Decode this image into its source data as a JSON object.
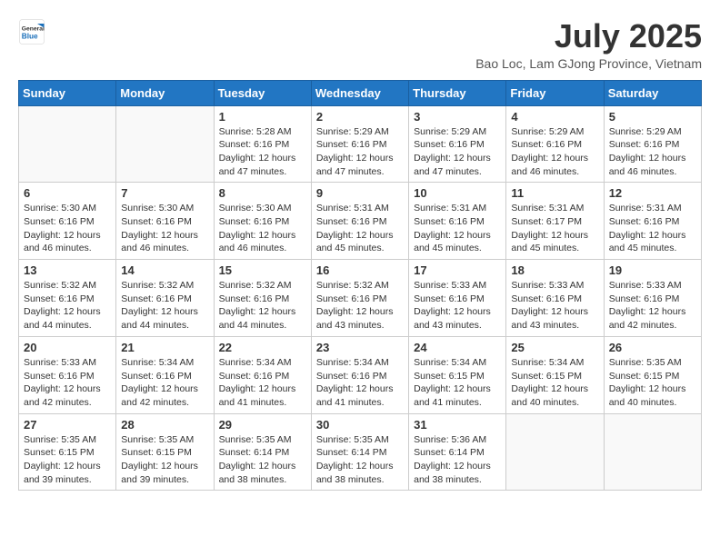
{
  "header": {
    "logo_general": "General",
    "logo_blue": "Blue",
    "month_year": "July 2025",
    "location": "Bao Loc, Lam GJong Province, Vietnam"
  },
  "days_of_week": [
    "Sunday",
    "Monday",
    "Tuesday",
    "Wednesday",
    "Thursday",
    "Friday",
    "Saturday"
  ],
  "weeks": [
    [
      {
        "day": "",
        "info": ""
      },
      {
        "day": "",
        "info": ""
      },
      {
        "day": "1",
        "info": "Sunrise: 5:28 AM\nSunset: 6:16 PM\nDaylight: 12 hours and 47 minutes."
      },
      {
        "day": "2",
        "info": "Sunrise: 5:29 AM\nSunset: 6:16 PM\nDaylight: 12 hours and 47 minutes."
      },
      {
        "day": "3",
        "info": "Sunrise: 5:29 AM\nSunset: 6:16 PM\nDaylight: 12 hours and 47 minutes."
      },
      {
        "day": "4",
        "info": "Sunrise: 5:29 AM\nSunset: 6:16 PM\nDaylight: 12 hours and 46 minutes."
      },
      {
        "day": "5",
        "info": "Sunrise: 5:29 AM\nSunset: 6:16 PM\nDaylight: 12 hours and 46 minutes."
      }
    ],
    [
      {
        "day": "6",
        "info": "Sunrise: 5:30 AM\nSunset: 6:16 PM\nDaylight: 12 hours and 46 minutes."
      },
      {
        "day": "7",
        "info": "Sunrise: 5:30 AM\nSunset: 6:16 PM\nDaylight: 12 hours and 46 minutes."
      },
      {
        "day": "8",
        "info": "Sunrise: 5:30 AM\nSunset: 6:16 PM\nDaylight: 12 hours and 46 minutes."
      },
      {
        "day": "9",
        "info": "Sunrise: 5:31 AM\nSunset: 6:16 PM\nDaylight: 12 hours and 45 minutes."
      },
      {
        "day": "10",
        "info": "Sunrise: 5:31 AM\nSunset: 6:16 PM\nDaylight: 12 hours and 45 minutes."
      },
      {
        "day": "11",
        "info": "Sunrise: 5:31 AM\nSunset: 6:17 PM\nDaylight: 12 hours and 45 minutes."
      },
      {
        "day": "12",
        "info": "Sunrise: 5:31 AM\nSunset: 6:16 PM\nDaylight: 12 hours and 45 minutes."
      }
    ],
    [
      {
        "day": "13",
        "info": "Sunrise: 5:32 AM\nSunset: 6:16 PM\nDaylight: 12 hours and 44 minutes."
      },
      {
        "day": "14",
        "info": "Sunrise: 5:32 AM\nSunset: 6:16 PM\nDaylight: 12 hours and 44 minutes."
      },
      {
        "day": "15",
        "info": "Sunrise: 5:32 AM\nSunset: 6:16 PM\nDaylight: 12 hours and 44 minutes."
      },
      {
        "day": "16",
        "info": "Sunrise: 5:32 AM\nSunset: 6:16 PM\nDaylight: 12 hours and 43 minutes."
      },
      {
        "day": "17",
        "info": "Sunrise: 5:33 AM\nSunset: 6:16 PM\nDaylight: 12 hours and 43 minutes."
      },
      {
        "day": "18",
        "info": "Sunrise: 5:33 AM\nSunset: 6:16 PM\nDaylight: 12 hours and 43 minutes."
      },
      {
        "day": "19",
        "info": "Sunrise: 5:33 AM\nSunset: 6:16 PM\nDaylight: 12 hours and 42 minutes."
      }
    ],
    [
      {
        "day": "20",
        "info": "Sunrise: 5:33 AM\nSunset: 6:16 PM\nDaylight: 12 hours and 42 minutes."
      },
      {
        "day": "21",
        "info": "Sunrise: 5:34 AM\nSunset: 6:16 PM\nDaylight: 12 hours and 42 minutes."
      },
      {
        "day": "22",
        "info": "Sunrise: 5:34 AM\nSunset: 6:16 PM\nDaylight: 12 hours and 41 minutes."
      },
      {
        "day": "23",
        "info": "Sunrise: 5:34 AM\nSunset: 6:16 PM\nDaylight: 12 hours and 41 minutes."
      },
      {
        "day": "24",
        "info": "Sunrise: 5:34 AM\nSunset: 6:15 PM\nDaylight: 12 hours and 41 minutes."
      },
      {
        "day": "25",
        "info": "Sunrise: 5:34 AM\nSunset: 6:15 PM\nDaylight: 12 hours and 40 minutes."
      },
      {
        "day": "26",
        "info": "Sunrise: 5:35 AM\nSunset: 6:15 PM\nDaylight: 12 hours and 40 minutes."
      }
    ],
    [
      {
        "day": "27",
        "info": "Sunrise: 5:35 AM\nSunset: 6:15 PM\nDaylight: 12 hours and 39 minutes."
      },
      {
        "day": "28",
        "info": "Sunrise: 5:35 AM\nSunset: 6:15 PM\nDaylight: 12 hours and 39 minutes."
      },
      {
        "day": "29",
        "info": "Sunrise: 5:35 AM\nSunset: 6:14 PM\nDaylight: 12 hours and 38 minutes."
      },
      {
        "day": "30",
        "info": "Sunrise: 5:35 AM\nSunset: 6:14 PM\nDaylight: 12 hours and 38 minutes."
      },
      {
        "day": "31",
        "info": "Sunrise: 5:36 AM\nSunset: 6:14 PM\nDaylight: 12 hours and 38 minutes."
      },
      {
        "day": "",
        "info": ""
      },
      {
        "day": "",
        "info": ""
      }
    ]
  ]
}
